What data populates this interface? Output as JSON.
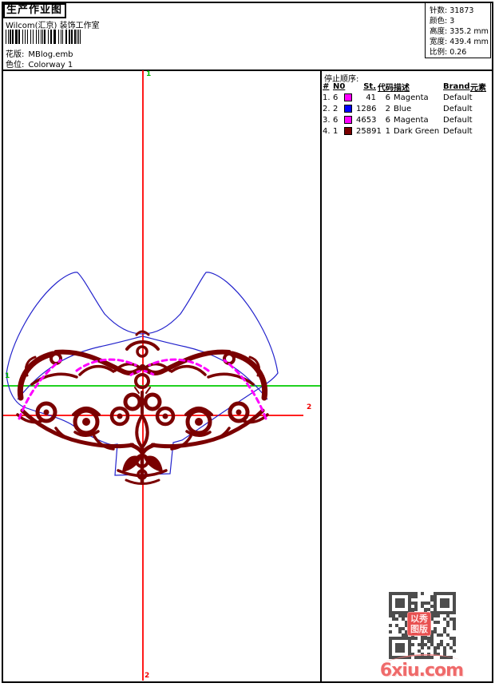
{
  "page": {
    "title": "生产作业图",
    "subtitle": "Wilcom(汇京) 装饰工作室"
  },
  "design_info": {
    "pattern_label": "花版:",
    "pattern_value": "MBlog.emb",
    "colorway_label": "色位:",
    "colorway_value": "Colorway 1"
  },
  "stats": {
    "0": {
      "label": "针数:",
      "value": "31873"
    },
    "1": {
      "label": "颜色:",
      "value": "3"
    },
    "2": {
      "label": "高度:",
      "value": "335.2 mm"
    },
    "3": {
      "label": "宽度:",
      "value": "439.4 mm"
    },
    "4": {
      "label": "比例:",
      "value": "0.26"
    }
  },
  "stop_sequence": {
    "title": "停止顺序:",
    "columns": {
      "num": "#",
      "n0": "N0",
      "st": "St.",
      "code": "代码",
      "desc": "描述",
      "brand": "Brand",
      "element": "元素"
    },
    "rows": {
      "0": {
        "num": "1.",
        "n0": "6",
        "color": "#ff00ff",
        "st": "41",
        "code": "6",
        "desc": "Magenta",
        "brand": "Default"
      },
      "1": {
        "num": "2.",
        "n0": "2",
        "color": "#0000ff",
        "st": "1286",
        "code": "2",
        "desc": "Blue",
        "brand": "Default"
      },
      "2": {
        "num": "3.",
        "n0": "6",
        "color": "#ff00ff",
        "st": "4653",
        "code": "6",
        "desc": "Magenta",
        "brand": "Default"
      },
      "3": {
        "num": "4.",
        "n0": "1",
        "color": "#7a0000",
        "st": "25891",
        "code": "1",
        "desc": "Dark Green",
        "brand": "Default"
      }
    }
  },
  "markers": {
    "start": "1",
    "end": "2"
  },
  "watermark": {
    "site": "6xiu.com",
    "seal_line1": "以秀",
    "seal_line2": "图版"
  },
  "colors": {
    "crosshair_red": "#ff0000",
    "guide_green": "#00cc00",
    "lace_dark_red": "#7a0000",
    "accent_magenta": "#ff00ff",
    "outline_blue": "#2222cc",
    "watermark_pink": "#ef6a6a"
  }
}
